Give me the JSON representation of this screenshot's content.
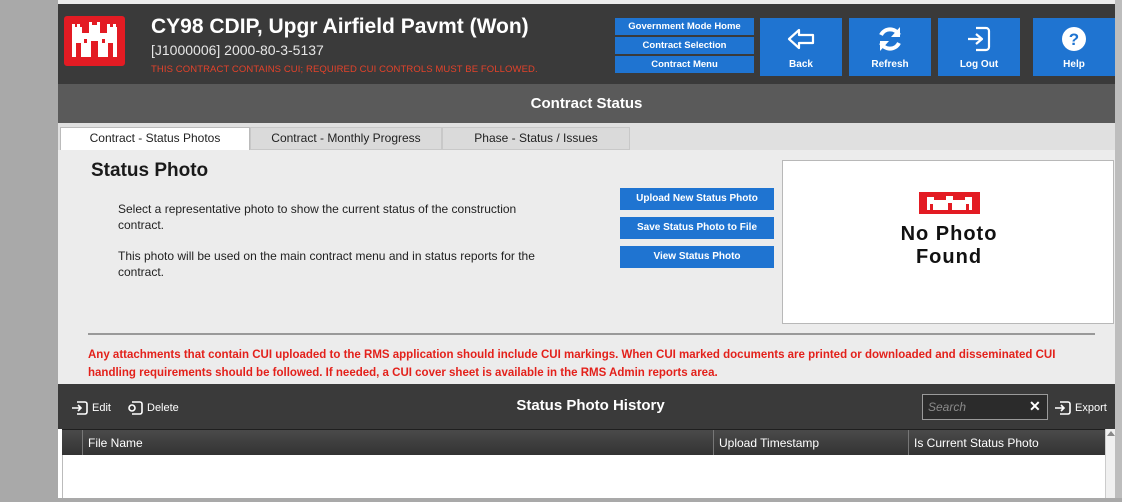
{
  "header": {
    "title": "CY98 CDIP, Upgr Airfield Pavmt (Won)",
    "subtitle": "[J1000006] 2000-80-3-5137",
    "cui_warning": "THIS CONTRACT CONTAINS CUI; REQUIRED CUI CONTROLS MUST BE FOLLOWED.",
    "nav_links": [
      "Government Mode Home",
      "Contract Selection",
      "Contract Menu"
    ],
    "buttons": {
      "back": "Back",
      "refresh": "Refresh",
      "logout": "Log Out",
      "help": "Help"
    }
  },
  "page_title": "Contract Status",
  "tabs": [
    {
      "label": "Contract - Status Photos",
      "active": true
    },
    {
      "label": "Contract - Monthly Progress",
      "active": false
    },
    {
      "label": "Phase - Status / Issues",
      "active": false
    }
  ],
  "status_photo": {
    "title": "Status Photo",
    "desc1": "Select a representative photo to show the current status of the construction contract.",
    "desc2": "This photo will be used on the main contract menu and in status reports for the contract.",
    "buttons": {
      "upload": "Upload New Status Photo",
      "save": "Save Status Photo to File",
      "view": "View Status Photo"
    },
    "no_photo_line1": "No Photo",
    "no_photo_line2": "Found"
  },
  "cui_notice": "Any attachments that contain CUI uploaded to the RMS application should include CUI markings. When CUI marked documents are printed or downloaded and disseminated CUI handling requirements should be followed. If needed, a CUI cover sheet is available in the RMS Admin reports area.",
  "history": {
    "title": "Status Photo History",
    "edit": "Edit",
    "delete": "Delete",
    "export": "Export",
    "search_placeholder": "Search",
    "columns": [
      "File Name",
      "Upload Timestamp",
      "Is Current Status Photo"
    ]
  },
  "colors": {
    "accent_blue": "#1f74d1",
    "header_dark": "#3a3a3a",
    "warning_red": "#e3211b",
    "logo_red": "#e31b23"
  }
}
